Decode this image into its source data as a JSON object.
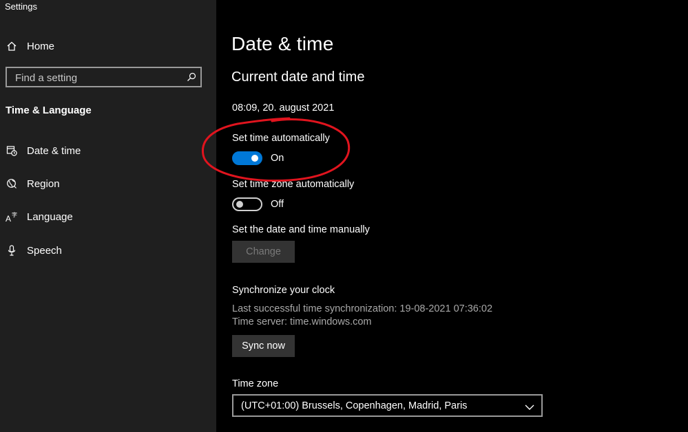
{
  "window": {
    "title": "Settings"
  },
  "sidebar": {
    "home_label": "Home",
    "search_placeholder": "Find a setting",
    "section_title": "Time & Language",
    "items": [
      {
        "label": "Date & time",
        "icon": "date-time-icon"
      },
      {
        "label": "Region",
        "icon": "globe-icon"
      },
      {
        "label": "Language",
        "icon": "language-icon"
      },
      {
        "label": "Speech",
        "icon": "microphone-icon"
      }
    ]
  },
  "main": {
    "title": "Date & time",
    "current_heading": "Current date and time",
    "current_value": "08:09, 20. august 2021",
    "auto_time": {
      "label": "Set time automatically",
      "state": "On"
    },
    "auto_zone": {
      "label": "Set time zone automatically",
      "state": "Off"
    },
    "manual": {
      "label": "Set the date and time manually",
      "button": "Change"
    },
    "sync": {
      "heading": "Synchronize your clock",
      "last_sync": "Last successful time synchronization: 19-08-2021 07:36:02",
      "server": "Time server: time.windows.com",
      "button": "Sync now"
    },
    "timezone": {
      "label": "Time zone",
      "value": "(UTC+01:00) Brussels, Copenhagen, Madrid, Paris"
    }
  },
  "colors": {
    "accent": "#0078d7",
    "annotation": "#e0141e",
    "sidebar_bg": "#1f1f1f",
    "main_bg": "#000000"
  }
}
